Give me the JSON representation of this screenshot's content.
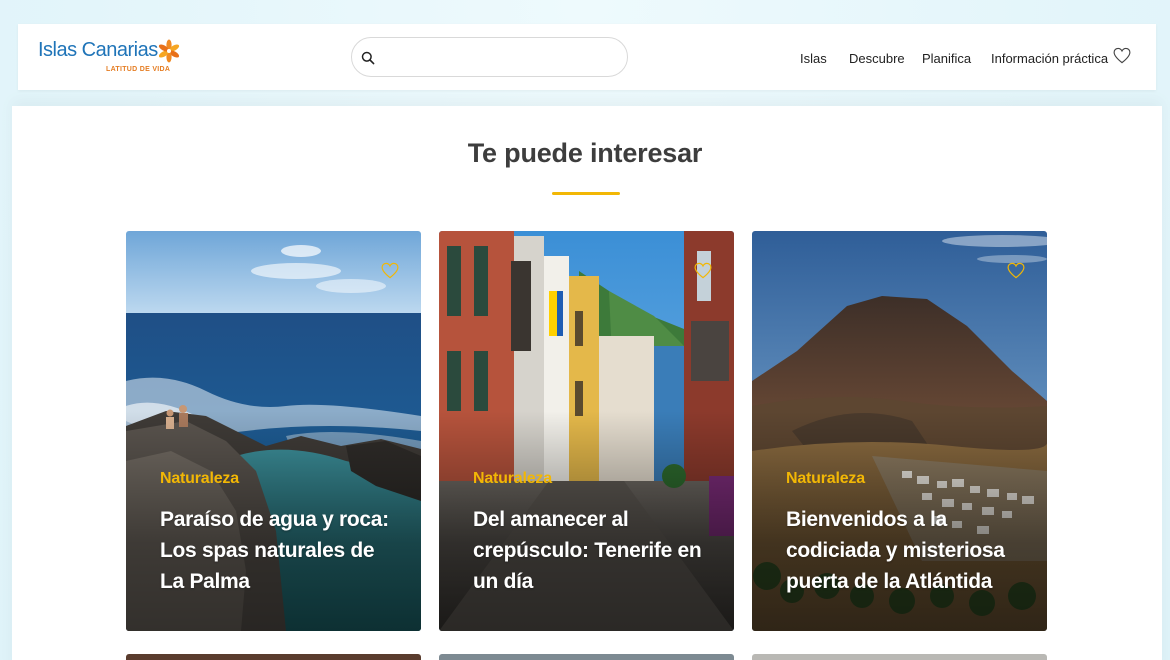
{
  "header": {
    "logo": {
      "name": "Islas Canarias",
      "tagline": "LATITUD DE VIDA"
    },
    "search": {
      "value": "",
      "placeholder": ""
    },
    "nav": [
      {
        "label": "Islas"
      },
      {
        "label": "Descubre"
      },
      {
        "label": "Planifica"
      },
      {
        "label": "Información práctica"
      }
    ],
    "favorites_icon": "heart-outline-icon"
  },
  "section": {
    "title": "Te puede interesar"
  },
  "cards": [
    {
      "category": "Naturaleza",
      "title": "Paraíso de agua y roca: Los spas naturales de La Palma",
      "icon": "heart-outline-icon"
    },
    {
      "category": "Naturaleza",
      "title": "Del amanecer al crepúsculo: Tenerife en un día",
      "icon": "heart-outline-icon"
    },
    {
      "category": "Naturaleza",
      "title": "Bienvenidos a la codiciada y misteriosa puerta de la Atlántida",
      "icon": "heart-outline-icon"
    }
  ],
  "colors": {
    "accent": "#f2b705",
    "brand_blue": "#1f74b8",
    "brand_orange": "#e57d23",
    "page_bg": "#e3f5fa",
    "title_text": "#3d3d3d"
  }
}
